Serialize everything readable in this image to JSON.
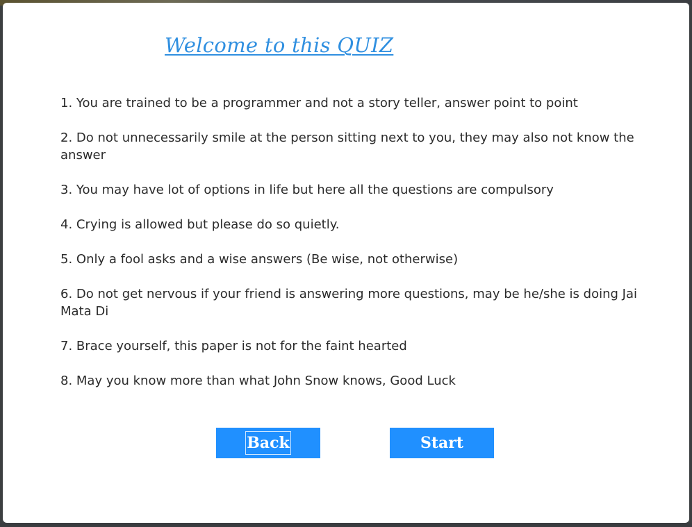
{
  "title": "Welcome to this QUIZ",
  "rules": [
    "1. You are trained to be a programmer and not a story teller, answer point to point",
    "2. Do not unnecessarily smile at the person sitting next to you, they may also not know the answer",
    "3. You may have lot of options in life but here all the questions are compulsory",
    "4. Crying is allowed but please do so quietly.",
    "5. Only a fool asks and a wise answers (Be wise, not otherwise)",
    "6. Do not get nervous if your friend is answering more questions, may be he/she is doing Jai Mata Di",
    "7. Brace yourself, this paper is not for the faint hearted",
    "8. May you know more than what John Snow knows, Good Luck"
  ],
  "buttons": {
    "back_label": "Back",
    "start_label": "Start"
  },
  "colors": {
    "title": "#2f8fe0",
    "button_bg": "#2090ff",
    "button_text": "#ffffff",
    "body_text": "#2b2b2b"
  }
}
